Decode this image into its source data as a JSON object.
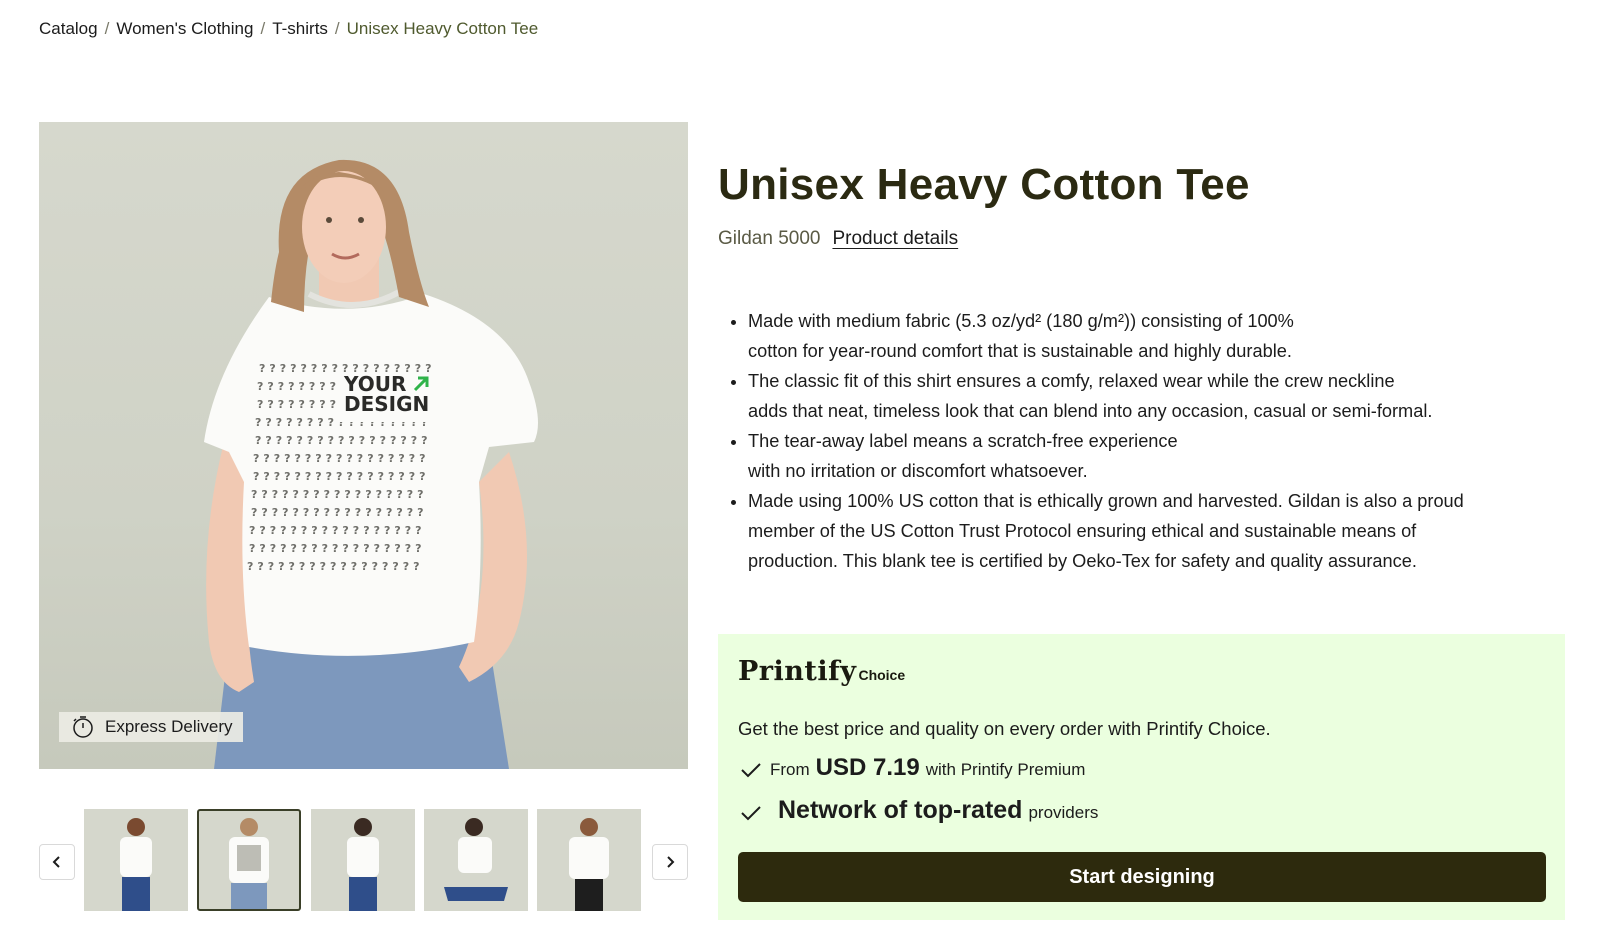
{
  "breadcrumb": {
    "items": [
      "Catalog",
      "Women's Clothing",
      "T-shirts"
    ],
    "current": "Unisex Heavy Cotton Tee",
    "separator": "/"
  },
  "hero": {
    "badge_label": "Express Delivery",
    "badge_icon": "stopwatch-icon",
    "print_text_line1": "YOUR",
    "print_text_line2": "DESIGN",
    "print_arrow_color": "#2fb34a"
  },
  "gallery": {
    "thumbnail_count": 5,
    "active_index": 1
  },
  "product": {
    "title": "Unisex Heavy Cotton Tee",
    "model": "Gildan 5000",
    "details_link": "Product details",
    "features": [
      [
        "Made with medium fabric (5.3 oz/yd² (180 g/m²)) consisting of 100%",
        "cotton for year-round comfort that is sustainable and highly durable."
      ],
      [
        "The classic fit of this shirt ensures a comfy, relaxed wear while the crew neckline",
        "adds that neat, timeless look that can blend into any occasion, casual or semi-formal."
      ],
      [
        "The tear-away label means a scratch-free experience",
        "with no irritation or discomfort whatsoever."
      ],
      [
        "Made using 100% US cotton that is ethically grown and harvested. Gildan is also a proud",
        "member of the US Cotton Trust Protocol ensuring ethical and sustainable means of",
        "production. This blank tee is certified by Oeko-Tex for safety and quality assurance."
      ]
    ]
  },
  "choice": {
    "brand": "Printify",
    "brand_suffix": "Choice",
    "tagline": "Get the best price and quality on every order with Printify Choice.",
    "perk1_prefix": "From",
    "perk1_price": "USD 7.19",
    "perk1_suffix": "with Printify Premium",
    "perk2_bold": "Network of top-rated",
    "perk2_suffix": "providers",
    "cta_label": "Start designing"
  },
  "colors": {
    "panel_bg": "#ebffdf",
    "cta_bg": "#2d2a0d",
    "title": "#2b2a12",
    "breadcrumb_current": "#4f5a2e"
  }
}
